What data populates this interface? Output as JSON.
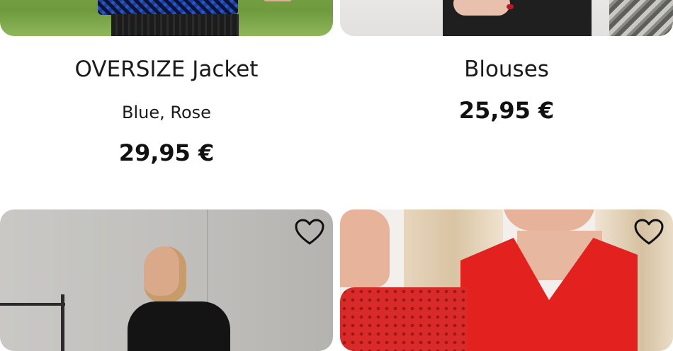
{
  "products": [
    {
      "name": "OVERSIZE Jacket",
      "variants": "Blue, Rose",
      "price": "29,95 €"
    },
    {
      "name": "Blouses",
      "price": "25,95 €"
    },
    {
      "favorite_icon": "heart-outline-icon"
    },
    {
      "favorite_icon": "heart-outline-icon"
    }
  ],
  "colors": {
    "text": "#1b1b1b",
    "background": "#ffffff"
  }
}
